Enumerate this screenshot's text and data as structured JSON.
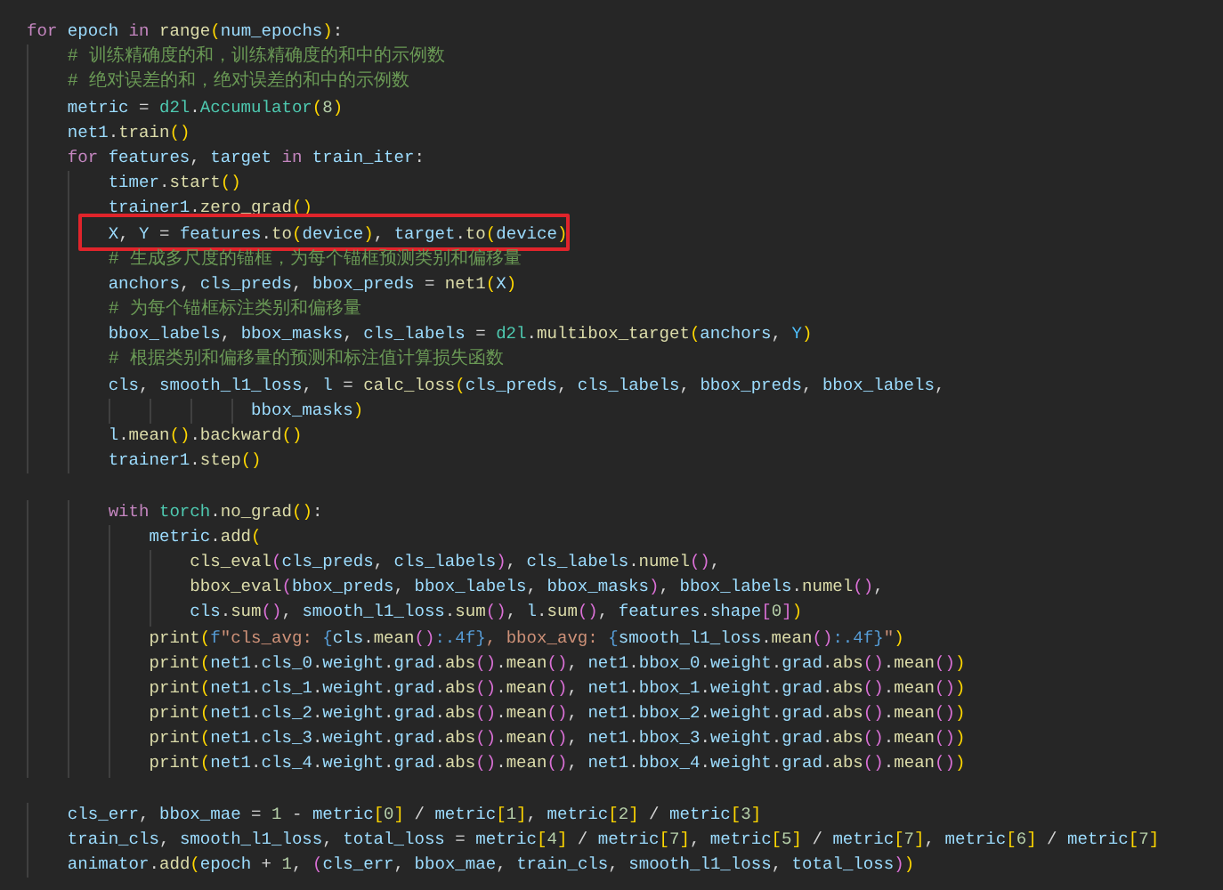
{
  "editor": {
    "lines": [
      {
        "kind": "code",
        "tokens": [
          {
            "text": "for",
            "kind": "keyword"
          },
          {
            "text": " epoch ",
            "kind": "variable"
          },
          {
            "text": "in",
            "kind": "keyword"
          },
          {
            "text": " range",
            "kind": "function"
          },
          {
            "text": "(",
            "kind": "bracket"
          },
          {
            "text": "num_epochs",
            "kind": "variable"
          },
          {
            "text": ")",
            "kind": "bracket"
          },
          {
            "text": ":",
            "kind": "plain"
          }
        ]
      },
      {
        "kind": "code",
        "tokens": [
          {
            "text": "    # 训练精确度的和，训练精确度的和中的示例数",
            "kind": "comment"
          }
        ]
      },
      {
        "kind": "code",
        "tokens": [
          {
            "text": "    # 绝对误差的和，绝对误差的和中的示例数",
            "kind": "comment"
          }
        ]
      },
      {
        "kind": "code",
        "tokens": [
          {
            "text": "    metric",
            "kind": "variable"
          },
          {
            "text": " = ",
            "kind": "plain"
          },
          {
            "text": "d2l",
            "kind": "type"
          },
          {
            "text": ".",
            "kind": "plain"
          },
          {
            "text": "Accumulator",
            "kind": "type"
          },
          {
            "text": "(",
            "kind": "bracket"
          },
          {
            "text": "8",
            "kind": "number"
          },
          {
            "text": ")",
            "kind": "bracket"
          }
        ]
      },
      {
        "kind": "code",
        "tokens": [
          {
            "text": "    net1",
            "kind": "variable"
          },
          {
            "text": ".",
            "kind": "plain"
          },
          {
            "text": "train",
            "kind": "function"
          },
          {
            "text": "()",
            "kind": "bracket"
          }
        ]
      },
      {
        "kind": "code",
        "tokens": [
          {
            "text": "    for",
            "kind": "keyword"
          },
          {
            "text": " features",
            "kind": "variable"
          },
          {
            "text": ", ",
            "kind": "plain"
          },
          {
            "text": "target",
            "kind": "variable"
          },
          {
            "text": " in",
            "kind": "keyword"
          },
          {
            "text": " train_iter",
            "kind": "variable"
          },
          {
            "text": ":",
            "kind": "plain"
          }
        ]
      },
      {
        "kind": "code",
        "tokens": [
          {
            "text": "        timer",
            "kind": "variable"
          },
          {
            "text": ".",
            "kind": "plain"
          },
          {
            "text": "start",
            "kind": "function"
          },
          {
            "text": "()",
            "kind": "bracket"
          }
        ]
      },
      {
        "kind": "code",
        "tokens": [
          {
            "text": "        trainer1",
            "kind": "variable"
          },
          {
            "text": ".",
            "kind": "plain"
          },
          {
            "text": "zero_grad",
            "kind": "function"
          },
          {
            "text": "()",
            "kind": "bracket"
          }
        ]
      },
      {
        "kind": "code",
        "highlighted": true,
        "tokens": [
          {
            "text": "        X",
            "kind": "variable"
          },
          {
            "text": ", ",
            "kind": "plain"
          },
          {
            "text": "Y",
            "kind": "variable"
          },
          {
            "text": " = ",
            "kind": "plain"
          },
          {
            "text": "features",
            "kind": "variable"
          },
          {
            "text": ".",
            "kind": "plain"
          },
          {
            "text": "to",
            "kind": "function"
          },
          {
            "text": "(",
            "kind": "bracket"
          },
          {
            "text": "device",
            "kind": "variable"
          },
          {
            "text": ")",
            "kind": "bracket"
          },
          {
            "text": ", ",
            "kind": "plain"
          },
          {
            "text": "target",
            "kind": "variable"
          },
          {
            "text": ".",
            "kind": "plain"
          },
          {
            "text": "to",
            "kind": "function"
          },
          {
            "text": "(",
            "kind": "bracket"
          },
          {
            "text": "device",
            "kind": "variable"
          },
          {
            "text": ")",
            "kind": "bracket"
          }
        ]
      },
      {
        "kind": "code",
        "tokens": [
          {
            "text": "        # 生成多尺度的锚框，为每个锚框预测类别和偏移量",
            "kind": "comment"
          }
        ]
      },
      {
        "kind": "code",
        "tokens": [
          {
            "text": "        anchors",
            "kind": "variable"
          },
          {
            "text": ", ",
            "kind": "plain"
          },
          {
            "text": "cls_preds",
            "kind": "variable"
          },
          {
            "text": ", ",
            "kind": "plain"
          },
          {
            "text": "bbox_preds",
            "kind": "variable"
          },
          {
            "text": " = ",
            "kind": "plain"
          },
          {
            "text": "net1",
            "kind": "function"
          },
          {
            "text": "(",
            "kind": "bracket"
          },
          {
            "text": "X",
            "kind": "variable"
          },
          {
            "text": ")",
            "kind": "bracket"
          }
        ]
      },
      {
        "kind": "code",
        "tokens": [
          {
            "text": "        # 为每个锚框标注类别和偏移量",
            "kind": "comment"
          }
        ]
      },
      {
        "kind": "code",
        "tokens": [
          {
            "text": "        bbox_labels",
            "kind": "variable"
          },
          {
            "text": ", ",
            "kind": "plain"
          },
          {
            "text": "bbox_masks",
            "kind": "variable"
          },
          {
            "text": ", ",
            "kind": "plain"
          },
          {
            "text": "cls_labels",
            "kind": "variable"
          },
          {
            "text": " = ",
            "kind": "plain"
          },
          {
            "text": "d2l",
            "kind": "type"
          },
          {
            "text": ".",
            "kind": "plain"
          },
          {
            "text": "multibox_target",
            "kind": "function"
          },
          {
            "text": "(",
            "kind": "bracket"
          },
          {
            "text": "anchors",
            "kind": "variable"
          },
          {
            "text": ", ",
            "kind": "plain"
          },
          {
            "text": "Y",
            "kind": "constant"
          },
          {
            "text": ")",
            "kind": "bracket"
          }
        ]
      },
      {
        "kind": "code",
        "tokens": [
          {
            "text": "        # 根据类别和偏移量的预测和标注值计算损失函数",
            "kind": "comment"
          }
        ]
      },
      {
        "kind": "code",
        "tokens": [
          {
            "text": "        cls",
            "kind": "variable"
          },
          {
            "text": ", ",
            "kind": "plain"
          },
          {
            "text": "smooth_l1_loss",
            "kind": "variable"
          },
          {
            "text": ", ",
            "kind": "plain"
          },
          {
            "text": "l",
            "kind": "variable"
          },
          {
            "text": " = ",
            "kind": "plain"
          },
          {
            "text": "calc_loss",
            "kind": "function"
          },
          {
            "text": "(",
            "kind": "bracket"
          },
          {
            "text": "cls_preds",
            "kind": "variable"
          },
          {
            "text": ", ",
            "kind": "plain"
          },
          {
            "text": "cls_labels",
            "kind": "variable"
          },
          {
            "text": ", ",
            "kind": "plain"
          },
          {
            "text": "bbox_preds",
            "kind": "variable"
          },
          {
            "text": ", ",
            "kind": "plain"
          },
          {
            "text": "bbox_labels",
            "kind": "variable"
          },
          {
            "text": ",",
            "kind": "plain"
          }
        ]
      },
      {
        "kind": "code",
        "tokens": [
          {
            "text": "                      bbox_masks",
            "kind": "variable"
          },
          {
            "text": ")",
            "kind": "bracket"
          }
        ]
      },
      {
        "kind": "code",
        "tokens": [
          {
            "text": "        l",
            "kind": "variable"
          },
          {
            "text": ".",
            "kind": "plain"
          },
          {
            "text": "mean",
            "kind": "function"
          },
          {
            "text": "()",
            "kind": "bracket"
          },
          {
            "text": ".",
            "kind": "plain"
          },
          {
            "text": "backward",
            "kind": "function"
          },
          {
            "text": "()",
            "kind": "bracket"
          }
        ]
      },
      {
        "kind": "code",
        "tokens": [
          {
            "text": "        trainer1",
            "kind": "variable"
          },
          {
            "text": ".",
            "kind": "plain"
          },
          {
            "text": "step",
            "kind": "function"
          },
          {
            "text": "()",
            "kind": "bracket"
          }
        ]
      },
      {
        "kind": "blank"
      },
      {
        "kind": "code",
        "tokens": [
          {
            "text": "        with",
            "kind": "keyword"
          },
          {
            "text": " torch",
            "kind": "type"
          },
          {
            "text": ".",
            "kind": "plain"
          },
          {
            "text": "no_grad",
            "kind": "function"
          },
          {
            "text": "()",
            "kind": "bracket"
          },
          {
            "text": ":",
            "kind": "plain"
          }
        ]
      },
      {
        "kind": "code",
        "tokens": [
          {
            "text": "            metric",
            "kind": "variable"
          },
          {
            "text": ".",
            "kind": "plain"
          },
          {
            "text": "add",
            "kind": "function"
          },
          {
            "text": "(",
            "kind": "bracket"
          }
        ]
      },
      {
        "kind": "code",
        "tokens": [
          {
            "text": "                cls_eval",
            "kind": "function"
          },
          {
            "text": "(",
            "kind": "innerbracket"
          },
          {
            "text": "cls_preds",
            "kind": "variable"
          },
          {
            "text": ", ",
            "kind": "plain"
          },
          {
            "text": "cls_labels",
            "kind": "variable"
          },
          {
            "text": ")",
            "kind": "innerbracket"
          },
          {
            "text": ", ",
            "kind": "plain"
          },
          {
            "text": "cls_labels",
            "kind": "variable"
          },
          {
            "text": ".",
            "kind": "plain"
          },
          {
            "text": "numel",
            "kind": "function"
          },
          {
            "text": "()",
            "kind": "innerbracket"
          },
          {
            "text": ",",
            "kind": "plain"
          }
        ]
      },
      {
        "kind": "code",
        "tokens": [
          {
            "text": "                bbox_eval",
            "kind": "function"
          },
          {
            "text": "(",
            "kind": "innerbracket"
          },
          {
            "text": "bbox_preds",
            "kind": "variable"
          },
          {
            "text": ", ",
            "kind": "plain"
          },
          {
            "text": "bbox_labels",
            "kind": "variable"
          },
          {
            "text": ", ",
            "kind": "plain"
          },
          {
            "text": "bbox_masks",
            "kind": "variable"
          },
          {
            "text": ")",
            "kind": "innerbracket"
          },
          {
            "text": ", ",
            "kind": "plain"
          },
          {
            "text": "bbox_labels",
            "kind": "variable"
          },
          {
            "text": ".",
            "kind": "plain"
          },
          {
            "text": "numel",
            "kind": "function"
          },
          {
            "text": "()",
            "kind": "innerbracket"
          },
          {
            "text": ",",
            "kind": "plain"
          }
        ]
      },
      {
        "kind": "code",
        "tokens": [
          {
            "text": "                cls",
            "kind": "variable"
          },
          {
            "text": ".",
            "kind": "plain"
          },
          {
            "text": "sum",
            "kind": "function"
          },
          {
            "text": "()",
            "kind": "innerbracket"
          },
          {
            "text": ", ",
            "kind": "plain"
          },
          {
            "text": "smooth_l1_loss",
            "kind": "variable"
          },
          {
            "text": ".",
            "kind": "plain"
          },
          {
            "text": "sum",
            "kind": "function"
          },
          {
            "text": "()",
            "kind": "innerbracket"
          },
          {
            "text": ", ",
            "kind": "plain"
          },
          {
            "text": "l",
            "kind": "variable"
          },
          {
            "text": ".",
            "kind": "plain"
          },
          {
            "text": "sum",
            "kind": "function"
          },
          {
            "text": "()",
            "kind": "innerbracket"
          },
          {
            "text": ", ",
            "kind": "plain"
          },
          {
            "text": "features",
            "kind": "variable"
          },
          {
            "text": ".",
            "kind": "plain"
          },
          {
            "text": "shape",
            "kind": "variable"
          },
          {
            "text": "[",
            "kind": "innerbracket"
          },
          {
            "text": "0",
            "kind": "number"
          },
          {
            "text": "]",
            "kind": "innerbracket"
          },
          {
            "text": ")",
            "kind": "bracket"
          }
        ]
      },
      {
        "kind": "code",
        "tokens": [
          {
            "text": "            print",
            "kind": "function"
          },
          {
            "text": "(",
            "kind": "bracket"
          },
          {
            "text": "f",
            "kind": "storage"
          },
          {
            "text": "\"cls_avg: ",
            "kind": "string"
          },
          {
            "text": "{",
            "kind": "storage"
          },
          {
            "text": "cls",
            "kind": "variable"
          },
          {
            "text": ".",
            "kind": "plain"
          },
          {
            "text": "mean",
            "kind": "function"
          },
          {
            "text": "()",
            "kind": "innerbracket"
          },
          {
            "text": ":.4f",
            "kind": "storage"
          },
          {
            "text": "}",
            "kind": "storage"
          },
          {
            "text": ", bbox_avg: ",
            "kind": "string"
          },
          {
            "text": "{",
            "kind": "storage"
          },
          {
            "text": "smooth_l1_loss",
            "kind": "variable"
          },
          {
            "text": ".",
            "kind": "plain"
          },
          {
            "text": "mean",
            "kind": "function"
          },
          {
            "text": "()",
            "kind": "innerbracket"
          },
          {
            "text": ":.4f",
            "kind": "storage"
          },
          {
            "text": "}",
            "kind": "storage"
          },
          {
            "text": "\"",
            "kind": "string"
          },
          {
            "text": ")",
            "kind": "bracket"
          }
        ]
      },
      {
        "kind": "code",
        "tokens": [
          {
            "text": "            print",
            "kind": "function"
          },
          {
            "text": "(",
            "kind": "bracket"
          },
          {
            "text": "net1",
            "kind": "variable"
          },
          {
            "text": ".",
            "kind": "plain"
          },
          {
            "text": "cls_0",
            "kind": "variable"
          },
          {
            "text": ".",
            "kind": "plain"
          },
          {
            "text": "weight",
            "kind": "variable"
          },
          {
            "text": ".",
            "kind": "plain"
          },
          {
            "text": "grad",
            "kind": "variable"
          },
          {
            "text": ".",
            "kind": "plain"
          },
          {
            "text": "abs",
            "kind": "function"
          },
          {
            "text": "()",
            "kind": "innerbracket"
          },
          {
            "text": ".",
            "kind": "plain"
          },
          {
            "text": "mean",
            "kind": "function"
          },
          {
            "text": "()",
            "kind": "innerbracket"
          },
          {
            "text": ", ",
            "kind": "plain"
          },
          {
            "text": "net1",
            "kind": "variable"
          },
          {
            "text": ".",
            "kind": "plain"
          },
          {
            "text": "bbox_0",
            "kind": "variable"
          },
          {
            "text": ".",
            "kind": "plain"
          },
          {
            "text": "weight",
            "kind": "variable"
          },
          {
            "text": ".",
            "kind": "plain"
          },
          {
            "text": "grad",
            "kind": "variable"
          },
          {
            "text": ".",
            "kind": "plain"
          },
          {
            "text": "abs",
            "kind": "function"
          },
          {
            "text": "()",
            "kind": "innerbracket"
          },
          {
            "text": ".",
            "kind": "plain"
          },
          {
            "text": "mean",
            "kind": "function"
          },
          {
            "text": "()",
            "kind": "innerbracket"
          },
          {
            "text": ")",
            "kind": "bracket"
          }
        ]
      },
      {
        "kind": "code",
        "tokens": [
          {
            "text": "            print",
            "kind": "function"
          },
          {
            "text": "(",
            "kind": "bracket"
          },
          {
            "text": "net1",
            "kind": "variable"
          },
          {
            "text": ".",
            "kind": "plain"
          },
          {
            "text": "cls_1",
            "kind": "variable"
          },
          {
            "text": ".",
            "kind": "plain"
          },
          {
            "text": "weight",
            "kind": "variable"
          },
          {
            "text": ".",
            "kind": "plain"
          },
          {
            "text": "grad",
            "kind": "variable"
          },
          {
            "text": ".",
            "kind": "plain"
          },
          {
            "text": "abs",
            "kind": "function"
          },
          {
            "text": "()",
            "kind": "innerbracket"
          },
          {
            "text": ".",
            "kind": "plain"
          },
          {
            "text": "mean",
            "kind": "function"
          },
          {
            "text": "()",
            "kind": "innerbracket"
          },
          {
            "text": ", ",
            "kind": "plain"
          },
          {
            "text": "net1",
            "kind": "variable"
          },
          {
            "text": ".",
            "kind": "plain"
          },
          {
            "text": "bbox_1",
            "kind": "variable"
          },
          {
            "text": ".",
            "kind": "plain"
          },
          {
            "text": "weight",
            "kind": "variable"
          },
          {
            "text": ".",
            "kind": "plain"
          },
          {
            "text": "grad",
            "kind": "variable"
          },
          {
            "text": ".",
            "kind": "plain"
          },
          {
            "text": "abs",
            "kind": "function"
          },
          {
            "text": "()",
            "kind": "innerbracket"
          },
          {
            "text": ".",
            "kind": "plain"
          },
          {
            "text": "mean",
            "kind": "function"
          },
          {
            "text": "()",
            "kind": "innerbracket"
          },
          {
            "text": ")",
            "kind": "bracket"
          }
        ]
      },
      {
        "kind": "code",
        "tokens": [
          {
            "text": "            print",
            "kind": "function"
          },
          {
            "text": "(",
            "kind": "bracket"
          },
          {
            "text": "net1",
            "kind": "variable"
          },
          {
            "text": ".",
            "kind": "plain"
          },
          {
            "text": "cls_2",
            "kind": "variable"
          },
          {
            "text": ".",
            "kind": "plain"
          },
          {
            "text": "weight",
            "kind": "variable"
          },
          {
            "text": ".",
            "kind": "plain"
          },
          {
            "text": "grad",
            "kind": "variable"
          },
          {
            "text": ".",
            "kind": "plain"
          },
          {
            "text": "abs",
            "kind": "function"
          },
          {
            "text": "()",
            "kind": "innerbracket"
          },
          {
            "text": ".",
            "kind": "plain"
          },
          {
            "text": "mean",
            "kind": "function"
          },
          {
            "text": "()",
            "kind": "innerbracket"
          },
          {
            "text": ", ",
            "kind": "plain"
          },
          {
            "text": "net1",
            "kind": "variable"
          },
          {
            "text": ".",
            "kind": "plain"
          },
          {
            "text": "bbox_2",
            "kind": "variable"
          },
          {
            "text": ".",
            "kind": "plain"
          },
          {
            "text": "weight",
            "kind": "variable"
          },
          {
            "text": ".",
            "kind": "plain"
          },
          {
            "text": "grad",
            "kind": "variable"
          },
          {
            "text": ".",
            "kind": "plain"
          },
          {
            "text": "abs",
            "kind": "function"
          },
          {
            "text": "()",
            "kind": "innerbracket"
          },
          {
            "text": ".",
            "kind": "plain"
          },
          {
            "text": "mean",
            "kind": "function"
          },
          {
            "text": "()",
            "kind": "innerbracket"
          },
          {
            "text": ")",
            "kind": "bracket"
          }
        ]
      },
      {
        "kind": "code",
        "tokens": [
          {
            "text": "            print",
            "kind": "function"
          },
          {
            "text": "(",
            "kind": "bracket"
          },
          {
            "text": "net1",
            "kind": "variable"
          },
          {
            "text": ".",
            "kind": "plain"
          },
          {
            "text": "cls_3",
            "kind": "variable"
          },
          {
            "text": ".",
            "kind": "plain"
          },
          {
            "text": "weight",
            "kind": "variable"
          },
          {
            "text": ".",
            "kind": "plain"
          },
          {
            "text": "grad",
            "kind": "variable"
          },
          {
            "text": ".",
            "kind": "plain"
          },
          {
            "text": "abs",
            "kind": "function"
          },
          {
            "text": "()",
            "kind": "innerbracket"
          },
          {
            "text": ".",
            "kind": "plain"
          },
          {
            "text": "mean",
            "kind": "function"
          },
          {
            "text": "()",
            "kind": "innerbracket"
          },
          {
            "text": ", ",
            "kind": "plain"
          },
          {
            "text": "net1",
            "kind": "variable"
          },
          {
            "text": ".",
            "kind": "plain"
          },
          {
            "text": "bbox_3",
            "kind": "variable"
          },
          {
            "text": ".",
            "kind": "plain"
          },
          {
            "text": "weight",
            "kind": "variable"
          },
          {
            "text": ".",
            "kind": "plain"
          },
          {
            "text": "grad",
            "kind": "variable"
          },
          {
            "text": ".",
            "kind": "plain"
          },
          {
            "text": "abs",
            "kind": "function"
          },
          {
            "text": "()",
            "kind": "innerbracket"
          },
          {
            "text": ".",
            "kind": "plain"
          },
          {
            "text": "mean",
            "kind": "function"
          },
          {
            "text": "()",
            "kind": "innerbracket"
          },
          {
            "text": ")",
            "kind": "bracket"
          }
        ]
      },
      {
        "kind": "code",
        "tokens": [
          {
            "text": "            print",
            "kind": "function"
          },
          {
            "text": "(",
            "kind": "bracket"
          },
          {
            "text": "net1",
            "kind": "variable"
          },
          {
            "text": ".",
            "kind": "plain"
          },
          {
            "text": "cls_4",
            "kind": "variable"
          },
          {
            "text": ".",
            "kind": "plain"
          },
          {
            "text": "weight",
            "kind": "variable"
          },
          {
            "text": ".",
            "kind": "plain"
          },
          {
            "text": "grad",
            "kind": "variable"
          },
          {
            "text": ".",
            "kind": "plain"
          },
          {
            "text": "abs",
            "kind": "function"
          },
          {
            "text": "()",
            "kind": "innerbracket"
          },
          {
            "text": ".",
            "kind": "plain"
          },
          {
            "text": "mean",
            "kind": "function"
          },
          {
            "text": "()",
            "kind": "innerbracket"
          },
          {
            "text": ", ",
            "kind": "plain"
          },
          {
            "text": "net1",
            "kind": "variable"
          },
          {
            "text": ".",
            "kind": "plain"
          },
          {
            "text": "bbox_4",
            "kind": "variable"
          },
          {
            "text": ".",
            "kind": "plain"
          },
          {
            "text": "weight",
            "kind": "variable"
          },
          {
            "text": ".",
            "kind": "plain"
          },
          {
            "text": "grad",
            "kind": "variable"
          },
          {
            "text": ".",
            "kind": "plain"
          },
          {
            "text": "abs",
            "kind": "function"
          },
          {
            "text": "()",
            "kind": "innerbracket"
          },
          {
            "text": ".",
            "kind": "plain"
          },
          {
            "text": "mean",
            "kind": "function"
          },
          {
            "text": "()",
            "kind": "innerbracket"
          },
          {
            "text": ")",
            "kind": "bracket"
          }
        ]
      },
      {
        "kind": "blank"
      },
      {
        "kind": "code",
        "tokens": [
          {
            "text": "    cls_err",
            "kind": "variable"
          },
          {
            "text": ", ",
            "kind": "plain"
          },
          {
            "text": "bbox_mae",
            "kind": "variable"
          },
          {
            "text": " = ",
            "kind": "plain"
          },
          {
            "text": "1",
            "kind": "number"
          },
          {
            "text": " - ",
            "kind": "plain"
          },
          {
            "text": "metric",
            "kind": "variable"
          },
          {
            "text": "[",
            "kind": "bracket"
          },
          {
            "text": "0",
            "kind": "number"
          },
          {
            "text": "]",
            "kind": "bracket"
          },
          {
            "text": " / ",
            "kind": "plain"
          },
          {
            "text": "metric",
            "kind": "variable"
          },
          {
            "text": "[",
            "kind": "bracket"
          },
          {
            "text": "1",
            "kind": "number"
          },
          {
            "text": "]",
            "kind": "bracket"
          },
          {
            "text": ", ",
            "kind": "plain"
          },
          {
            "text": "metric",
            "kind": "variable"
          },
          {
            "text": "[",
            "kind": "bracket"
          },
          {
            "text": "2",
            "kind": "number"
          },
          {
            "text": "]",
            "kind": "bracket"
          },
          {
            "text": " / ",
            "kind": "plain"
          },
          {
            "text": "metric",
            "kind": "variable"
          },
          {
            "text": "[",
            "kind": "bracket"
          },
          {
            "text": "3",
            "kind": "number"
          },
          {
            "text": "]",
            "kind": "bracket"
          }
        ]
      },
      {
        "kind": "code",
        "tokens": [
          {
            "text": "    train_cls",
            "kind": "variable"
          },
          {
            "text": ", ",
            "kind": "plain"
          },
          {
            "text": "smooth_l1_loss",
            "kind": "variable"
          },
          {
            "text": ", ",
            "kind": "plain"
          },
          {
            "text": "total_loss",
            "kind": "variable"
          },
          {
            "text": " = ",
            "kind": "plain"
          },
          {
            "text": "metric",
            "kind": "variable"
          },
          {
            "text": "[",
            "kind": "bracket"
          },
          {
            "text": "4",
            "kind": "number"
          },
          {
            "text": "]",
            "kind": "bracket"
          },
          {
            "text": " / ",
            "kind": "plain"
          },
          {
            "text": "metric",
            "kind": "variable"
          },
          {
            "text": "[",
            "kind": "bracket"
          },
          {
            "text": "7",
            "kind": "number"
          },
          {
            "text": "]",
            "kind": "bracket"
          },
          {
            "text": ", ",
            "kind": "plain"
          },
          {
            "text": "metric",
            "kind": "variable"
          },
          {
            "text": "[",
            "kind": "bracket"
          },
          {
            "text": "5",
            "kind": "number"
          },
          {
            "text": "]",
            "kind": "bracket"
          },
          {
            "text": " / ",
            "kind": "plain"
          },
          {
            "text": "metric",
            "kind": "variable"
          },
          {
            "text": "[",
            "kind": "bracket"
          },
          {
            "text": "7",
            "kind": "number"
          },
          {
            "text": "]",
            "kind": "bracket"
          },
          {
            "text": ", ",
            "kind": "plain"
          },
          {
            "text": "metric",
            "kind": "variable"
          },
          {
            "text": "[",
            "kind": "bracket"
          },
          {
            "text": "6",
            "kind": "number"
          },
          {
            "text": "]",
            "kind": "bracket"
          },
          {
            "text": " / ",
            "kind": "plain"
          },
          {
            "text": "metric",
            "kind": "variable"
          },
          {
            "text": "[",
            "kind": "bracket"
          },
          {
            "text": "7",
            "kind": "number"
          },
          {
            "text": "]",
            "kind": "bracket"
          }
        ]
      },
      {
        "kind": "code",
        "tokens": [
          {
            "text": "    animator",
            "kind": "variable"
          },
          {
            "text": ".",
            "kind": "plain"
          },
          {
            "text": "add",
            "kind": "function"
          },
          {
            "text": "(",
            "kind": "bracket"
          },
          {
            "text": "epoch",
            "kind": "variable"
          },
          {
            "text": " + ",
            "kind": "plain"
          },
          {
            "text": "1",
            "kind": "number"
          },
          {
            "text": ", ",
            "kind": "plain"
          },
          {
            "text": "(",
            "kind": "innerbracket"
          },
          {
            "text": "cls_err",
            "kind": "variable"
          },
          {
            "text": ", ",
            "kind": "plain"
          },
          {
            "text": "bbox_mae",
            "kind": "variable"
          },
          {
            "text": ", ",
            "kind": "plain"
          },
          {
            "text": "train_cls",
            "kind": "variable"
          },
          {
            "text": ", ",
            "kind": "plain"
          },
          {
            "text": "smooth_l1_loss",
            "kind": "variable"
          },
          {
            "text": ", ",
            "kind": "plain"
          },
          {
            "text": "total_loss",
            "kind": "variable"
          },
          {
            "text": ")",
            "kind": "innerbracket"
          },
          {
            "text": ")",
            "kind": "bracket"
          }
        ]
      }
    ]
  }
}
